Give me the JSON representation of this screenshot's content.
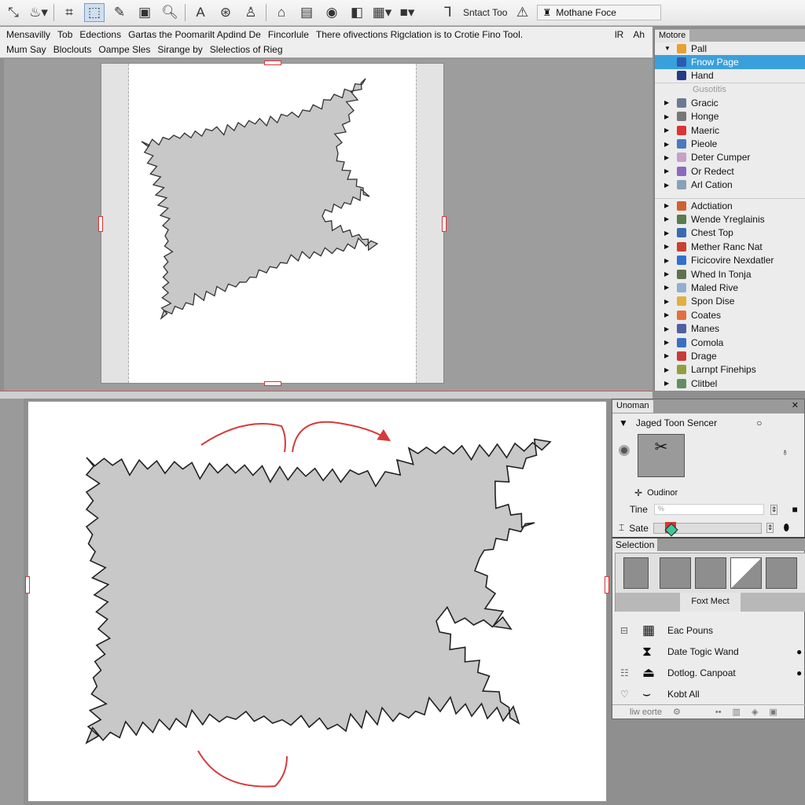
{
  "toolbar": {
    "select_tool_label": "Sntact Too",
    "font_field": "Mothane Foce"
  },
  "menus": {
    "row1": [
      "Mensavilly",
      "Tob",
      "Edections",
      "Gartas the Poomarilt Apdind De",
      "Fincorlule",
      "There ofivections Rigclation is to Crotie Fino Tool."
    ],
    "row1_right": [
      "lR",
      "Ah"
    ],
    "row2": [
      "Mum Say",
      "Bloclouts",
      "Oampe Sles",
      "Sirange by",
      "Slelectios of Rieg"
    ]
  },
  "layers_panel": {
    "tab": "Motore",
    "top_items": [
      {
        "label": "Pall",
        "expanded": true,
        "color": "#e8a030"
      },
      {
        "label": "Fnow Page",
        "selected": true,
        "color": "#2a5bb0"
      },
      {
        "label": "Hand",
        "color": "#223a8a"
      }
    ],
    "group_label": "Gusotitis",
    "items": [
      {
        "label": "Gracic",
        "color": "#6a7a90"
      },
      {
        "label": "Honge",
        "color": "#777"
      },
      {
        "label": "Maeric",
        "color": "#d33"
      },
      {
        "label": "Pieole",
        "color": "#4a7ac0"
      },
      {
        "label": "Deter Cumper",
        "color": "#c8a0c8"
      },
      {
        "label": "Or Redect",
        "color": "#8a6ac0"
      },
      {
        "label": "Arl Cation",
        "color": "#8aa0b8"
      }
    ],
    "items2": [
      {
        "label": "Adctiation",
        "color": "#d06030"
      },
      {
        "label": "Wende Yreglainis",
        "color": "#5a7a50"
      },
      {
        "label": "Chest Top",
        "color": "#3a6ab0"
      },
      {
        "label": "Mether Ranc Nat",
        "color": "#c84030"
      },
      {
        "label": "Ficicovire Nexdatler",
        "color": "#3070d0"
      },
      {
        "label": "Whed In Tonja",
        "color": "#607050"
      },
      {
        "label": "Maled Rive",
        "color": "#90b0d0"
      },
      {
        "label": "Spon Dise",
        "color": "#e0b040"
      },
      {
        "label": "Coates",
        "color": "#e07040"
      },
      {
        "label": "Manes",
        "color": "#5060a0"
      },
      {
        "label": "Comola",
        "color": "#3a70c0"
      },
      {
        "label": "Drage",
        "color": "#c83a3a"
      },
      {
        "label": "Larnpt Finehips",
        "color": "#90a040"
      },
      {
        "label": "Clitbel",
        "color": "#609060"
      }
    ]
  },
  "properties_panel": {
    "tab": "Unoman",
    "section": "Jaged Toon Sencer",
    "outline_label": "Oudinor",
    "time_label": "Tine",
    "time_value": "%",
    "size_label": "Sate"
  },
  "selection_panel": {
    "tab": "Selection",
    "button": "Foxt Mect",
    "tools": [
      {
        "label": "Eac Pouns",
        "icon": "grid-icon"
      },
      {
        "label": "Date Togic Wand",
        "icon": "magic-wand-icon",
        "info": true
      },
      {
        "label": "Dotlog. Canpoat",
        "icon": "stamp-icon",
        "info": true
      },
      {
        "label": "Kobt All",
        "icon": "select-all-icon"
      }
    ],
    "footer": "liw eorte"
  },
  "colors": {
    "accent": "#3aa0dc",
    "shape_fill": "#c8c8c8",
    "arrow": "#d63a3a"
  }
}
